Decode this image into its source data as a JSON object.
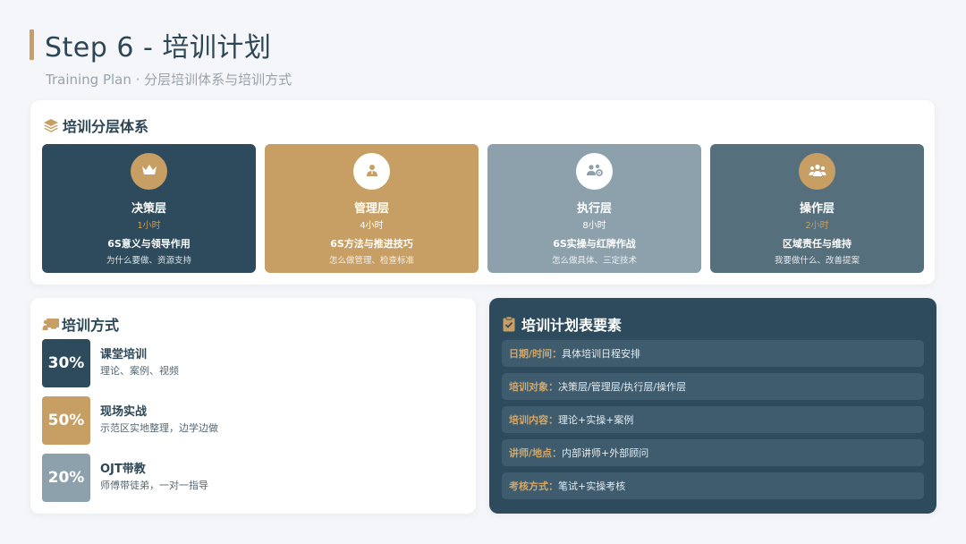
{
  "header": {
    "title": "Step 6 - 培训计划",
    "subtitle": "Training Plan · 分层培训体系与培训方式"
  },
  "hierarchy": {
    "title": "培训分层体系",
    "icon": "layers-icon",
    "tiers": [
      {
        "name": "决策层",
        "hours": "1小时",
        "topic": "6S意义与领导作用",
        "desc": "为什么要做、资源支持",
        "icon": "crown-icon",
        "bg": "#2d4b5c",
        "circle": "#c79e63",
        "hours_color": "#c79e63"
      },
      {
        "name": "管理层",
        "hours": "4小时",
        "topic": "6S方法与推进技巧",
        "desc": "怎么做管理、检查标准",
        "icon": "manager-icon",
        "bg": "#c79e63",
        "circle": "#ffffff",
        "hours_color": "#ffffff"
      },
      {
        "name": "执行层",
        "hours": "8小时",
        "topic": "6S实操与红牌作战",
        "desc": "怎么做具体、三定技术",
        "icon": "team-gear-icon",
        "bg": "#8da1ad",
        "circle": "#ffffff",
        "hours_color": "#ffffff"
      },
      {
        "name": "操作层",
        "hours": "2小时",
        "topic": "区域责任与维持",
        "desc": "我要做什么、改善提案",
        "icon": "group-icon",
        "bg": "#566f7d",
        "circle": "#c79e63",
        "hours_color": "#c79e63"
      }
    ]
  },
  "methods": {
    "title": "培训方式",
    "icon": "chalkboard-icon",
    "items": [
      {
        "percent": "30%",
        "title": "课堂培训",
        "desc": "理论、案例、视频",
        "color": "#2d4b5c"
      },
      {
        "percent": "50%",
        "title": "现场实战",
        "desc": "示范区实地整理，边学边做",
        "color": "#c79e63"
      },
      {
        "percent": "20%",
        "title": "OJT带教",
        "desc": "师傅带徒弟，一对一指导",
        "color": "#8da1ad"
      }
    ]
  },
  "elements": {
    "title": "培训计划表要素",
    "icon": "clipboard-check-icon",
    "rows": [
      {
        "key": "日期/时间",
        "value": "具体培训日程安排"
      },
      {
        "key": "培训对象",
        "value": "决策层/管理层/执行层/操作层"
      },
      {
        "key": "培训内容",
        "value": "理论+实操+案例"
      },
      {
        "key": "讲师/地点",
        "value": "内部讲师+外部顾问"
      },
      {
        "key": "考核方式",
        "value": "笔试+实操考核"
      }
    ],
    "separator": "："
  }
}
